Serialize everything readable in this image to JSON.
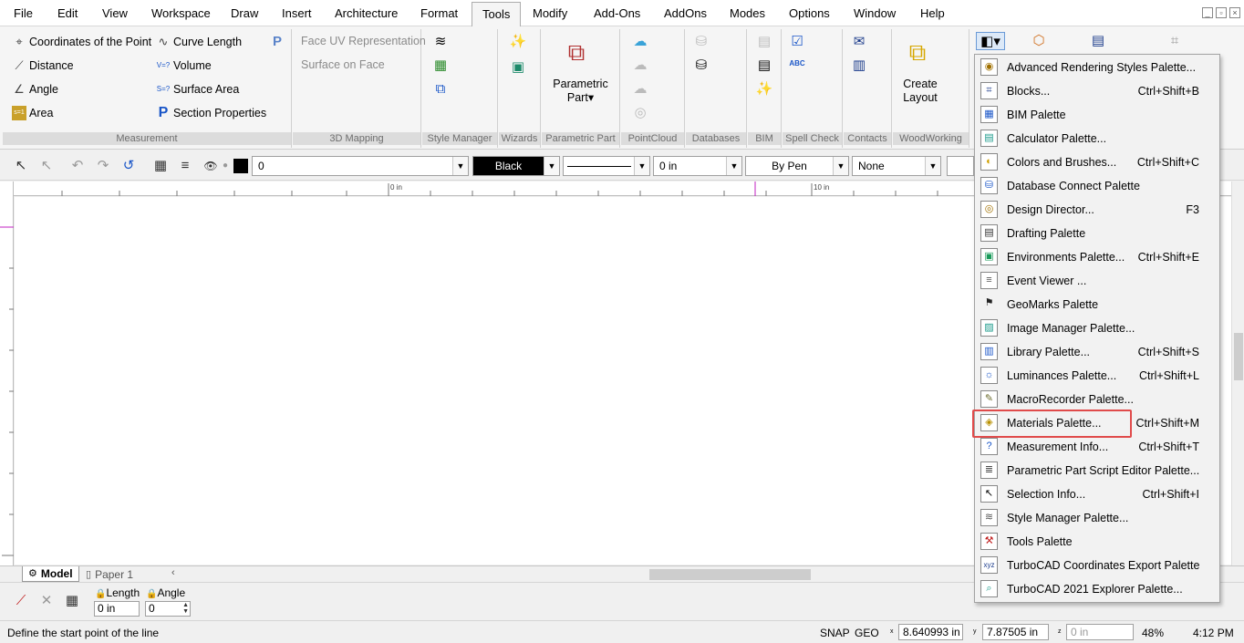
{
  "menubar": {
    "items": [
      "File",
      "Edit",
      "View",
      "Workspace",
      "Draw",
      "Insert",
      "Architecture",
      "Format",
      "Tools",
      "Modify",
      "Add-Ons",
      "AddOns",
      "Modes",
      "Options",
      "Window",
      "Help"
    ],
    "active": "Tools"
  },
  "ribbon": {
    "measurement": {
      "label": "Measurement",
      "coords": "Coordinates of the Point",
      "distance": "Distance",
      "angle": "Angle",
      "area": "Area",
      "curve_length": "Curve Length",
      "volume": "Volume",
      "surface_area": "Surface Area",
      "section_properties": "Section Properties"
    },
    "mapping": {
      "label": "3D Mapping",
      "face_uv": "Face UV Representation",
      "surface_on_face": "Surface on Face"
    },
    "style_manager": {
      "label": "Style Manager"
    },
    "wizards": {
      "label": "Wizards"
    },
    "parametric_part": {
      "label": "Parametric Part",
      "button_line1": "Parametric",
      "button_line2": "Part"
    },
    "pointcloud": {
      "label": "PointCloud"
    },
    "databases": {
      "label": "Databases"
    },
    "bim": {
      "label": "BIM"
    },
    "spell_check": {
      "label": "Spell Check",
      "abc": "ABC"
    },
    "contacts": {
      "label": "Contacts"
    },
    "woodworking": {
      "label": "WoodWorking",
      "button_line1": "Create",
      "button_line2": "Layout"
    }
  },
  "proptool": {
    "layer_value": "0",
    "color_value": "Black",
    "line_width_value": "0 in",
    "pen_value": "By Pen",
    "fill_value": "None"
  },
  "ruler": {
    "tick_0": "0 in",
    "tick_10": "10 in"
  },
  "tabs": {
    "model": "Model",
    "paper": "Paper 1"
  },
  "inspector": {
    "length_label": "Length",
    "length_value": "0 in",
    "angle_label": "Angle",
    "angle_value": "0"
  },
  "status": {
    "prompt": "Define the start point of the line",
    "snap": "SNAP",
    "geo": "GEO",
    "x_value": "8.640993 in",
    "y_value": "7.87505 in",
    "z_value": "0 in",
    "zoom": "48%",
    "time": "4:12 PM"
  },
  "dropdown": {
    "highlighted": "Materials Palette...",
    "items": [
      {
        "label": "Advanced Rendering Styles Palette...",
        "shortcut": "",
        "icon": "rendering-icon"
      },
      {
        "label": "Blocks...",
        "shortcut": "Ctrl+Shift+B",
        "icon": "blocks-icon"
      },
      {
        "label": "BIM Palette",
        "shortcut": "",
        "icon": "bim-icon"
      },
      {
        "label": "Calculator Palette...",
        "shortcut": "",
        "icon": "calculator-icon"
      },
      {
        "label": "Colors and Brushes...",
        "shortcut": "Ctrl+Shift+C",
        "icon": "palette-icon"
      },
      {
        "label": "Database Connect Palette",
        "shortcut": "",
        "icon": "database-icon"
      },
      {
        "label": "Design Director...",
        "shortcut": "F3",
        "icon": "design-director-icon"
      },
      {
        "label": "Drafting Palette",
        "shortcut": "",
        "icon": "drafting-icon"
      },
      {
        "label": "Environments Palette...",
        "shortcut": "Ctrl+Shift+E",
        "icon": "environment-icon"
      },
      {
        "label": "Event Viewer ...",
        "shortcut": "",
        "icon": "event-viewer-icon"
      },
      {
        "label": "GeoMarks Palette",
        "shortcut": "",
        "icon": "geomarks-icon"
      },
      {
        "label": "Image Manager Palette...",
        "shortcut": "",
        "icon": "image-manager-icon"
      },
      {
        "label": "Library Palette...",
        "shortcut": "Ctrl+Shift+S",
        "icon": "library-icon"
      },
      {
        "label": "Luminances Palette...",
        "shortcut": "Ctrl+Shift+L",
        "icon": "luminance-icon"
      },
      {
        "label": "MacroRecorder Palette...",
        "shortcut": "",
        "icon": "macro-recorder-icon"
      },
      {
        "label": "Materials Palette...",
        "shortcut": "Ctrl+Shift+M",
        "icon": "materials-icon"
      },
      {
        "label": "Measurement Info...",
        "shortcut": "Ctrl+Shift+T",
        "icon": "measurement-icon"
      },
      {
        "label": "Parametric Part Script Editor Palette...",
        "shortcut": "",
        "icon": "script-editor-icon"
      },
      {
        "label": "Selection Info...",
        "shortcut": "Ctrl+Shift+I",
        "icon": "selection-icon"
      },
      {
        "label": "Style Manager Palette...",
        "shortcut": "",
        "icon": "style-manager-icon"
      },
      {
        "label": "Tools Palette",
        "shortcut": "",
        "icon": "tools-icon"
      },
      {
        "label": "TurboCAD Coordinates Export Palette",
        "shortcut": "",
        "icon": "coordinates-export-icon"
      },
      {
        "label": "TurboCAD 2021 Explorer Palette...",
        "shortcut": "",
        "icon": "explorer-icon"
      }
    ]
  },
  "colors": {
    "highlight": "#e04b4b",
    "accent_blue": "#1a56c8"
  }
}
